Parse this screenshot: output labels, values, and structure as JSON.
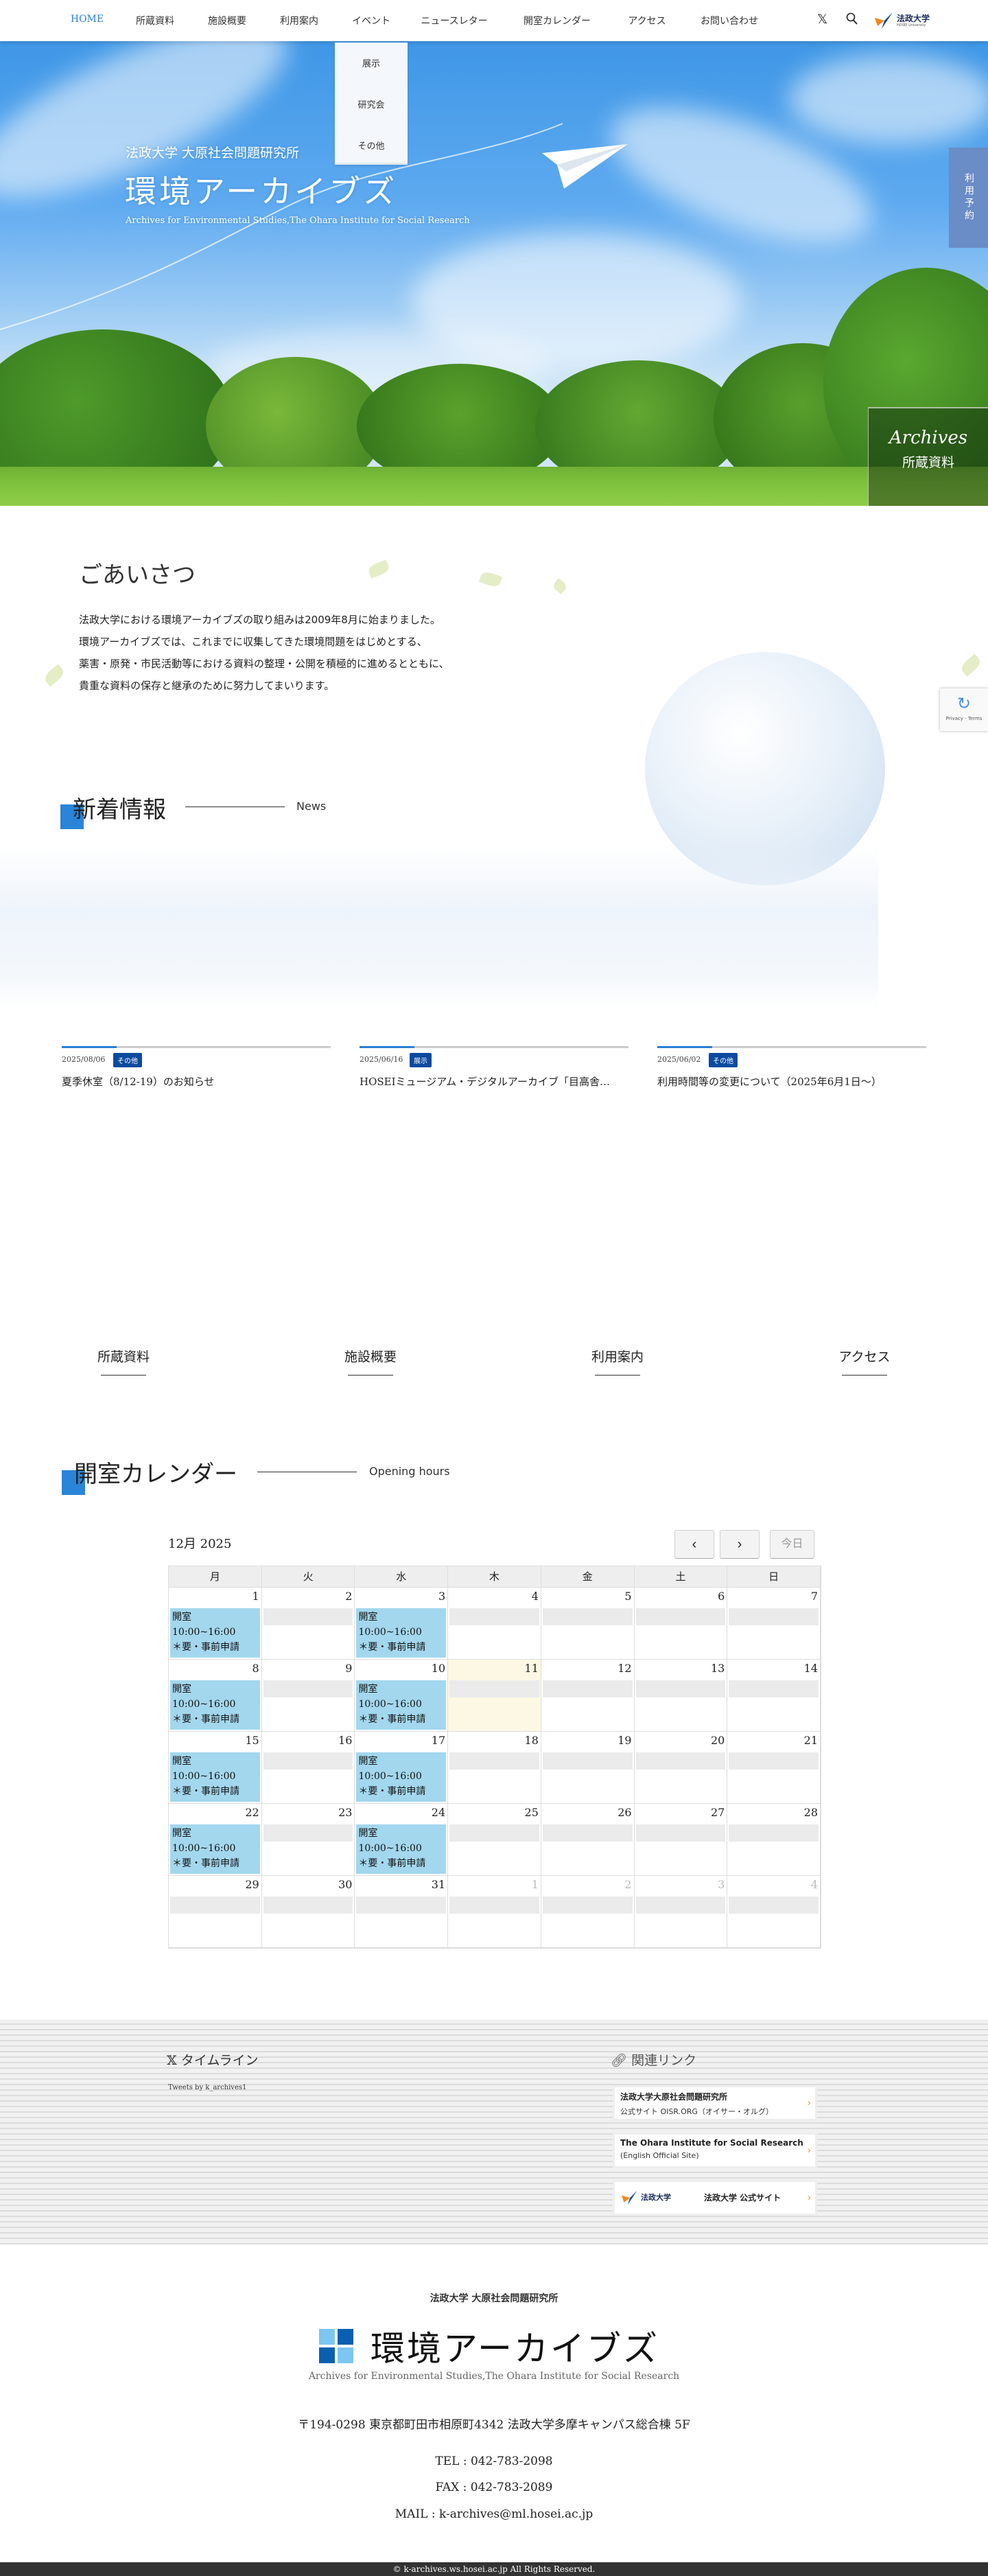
{
  "header": {
    "nav": [
      "HOME",
      "所蔵資料",
      "施設概要",
      "利用案内",
      "イベント",
      "ニュースレター",
      "開室カレンダー",
      "アクセス",
      "お問い合わせ"
    ],
    "event_dropdown": [
      "展示",
      "研究会",
      "その他"
    ],
    "logo_text": "法政大学",
    "logo_sub": "HOSEI University",
    "colors": {
      "accent": "#2a7fd4",
      "tag": "#0c4aa0",
      "reserve": "#6a8cc7"
    }
  },
  "hero": {
    "org": "法政大学 大原社会問題研究所",
    "title": "環境アーカイブズ",
    "subtitle": "Archives for Environmental Studies,The Ohara Institute for Social Research",
    "reserve_tab": "利用予約",
    "archives_script": "Archives",
    "archives_label": "所蔵資料"
  },
  "greeting": {
    "title": "ごあいさつ",
    "lines": [
      "法政大学における環境アーカイブズの取り組みは2009年8月に始まりました。",
      "環境アーカイブズでは、これまでに収集してきた環境問題をはじめとする、",
      "薬害・原発・市民活動等における資料の整理・公開を積極的に進めるとともに、",
      "貴重な資料の保存と継承のために努力してまいります。"
    ]
  },
  "news": {
    "title": "新着情報",
    "sub": "News",
    "items": [
      {
        "date": "2025/08/06",
        "tag": "その他",
        "title": "夏季休室（8/12-19）のお知らせ"
      },
      {
        "date": "2025/06/16",
        "tag": "展示",
        "title": "HOSEIミュージアム・デジタルアーカイブ「目高舎…"
      },
      {
        "date": "2025/06/02",
        "tag": "その他",
        "title": "利用時間等の変更について（2025年6月1日〜）"
      }
    ]
  },
  "quick_links": [
    "所蔵資料",
    "施設概要",
    "利用案内",
    "アクセス"
  ],
  "calendar": {
    "title": "開室カレンダー",
    "sub": "Opening hours",
    "month": "12月 2025",
    "prev": "‹",
    "next": "›",
    "today_btn": "今日",
    "weekdays": [
      "月",
      "火",
      "水",
      "木",
      "金",
      "土",
      "日"
    ],
    "event_lines": [
      "開室",
      "10:00~16:00",
      "＊要・事前申請"
    ],
    "weeks": [
      [
        {
          "d": 1,
          "open": true
        },
        {
          "d": 2
        },
        {
          "d": 3,
          "open": true
        },
        {
          "d": 4
        },
        {
          "d": 5
        },
        {
          "d": 6
        },
        {
          "d": 7
        }
      ],
      [
        {
          "d": 8,
          "open": true
        },
        {
          "d": 9
        },
        {
          "d": 10,
          "open": true
        },
        {
          "d": 11,
          "today": true
        },
        {
          "d": 12
        },
        {
          "d": 13
        },
        {
          "d": 14
        }
      ],
      [
        {
          "d": 15,
          "open": true
        },
        {
          "d": 16
        },
        {
          "d": 17,
          "open": true
        },
        {
          "d": 18
        },
        {
          "d": 19
        },
        {
          "d": 20
        },
        {
          "d": 21
        }
      ],
      [
        {
          "d": 22,
          "open": true
        },
        {
          "d": 23
        },
        {
          "d": 24,
          "open": true
        },
        {
          "d": 25
        },
        {
          "d": 26
        },
        {
          "d": 27
        },
        {
          "d": 28
        }
      ],
      [
        {
          "d": 29
        },
        {
          "d": 30
        },
        {
          "d": 31
        },
        {
          "d": 1,
          "other": true
        },
        {
          "d": 2,
          "other": true
        },
        {
          "d": 3,
          "other": true
        },
        {
          "d": 4,
          "other": true
        }
      ]
    ]
  },
  "timeline": {
    "title": "タイムライン",
    "tweets": "Tweets by k_archives1"
  },
  "related": {
    "title": "関連リンク",
    "items": [
      {
        "title": "法政大学大原社会問題研究所",
        "sub": "公式サイト OISR.ORG（オイサー・オルグ）"
      },
      {
        "title": "The Ohara Institute for Social Research",
        "sub": "(English Official Site)"
      },
      {
        "title": "法政大学 公式サイト",
        "logo": "法政大学"
      }
    ]
  },
  "footer": {
    "org": "法政大学 大原社会問題研究所",
    "logo_title": "環境アーカイブズ",
    "logo_sub": "Archives for Environmental Studies,The Ohara Institute for Social Research",
    "address": "〒194-0298 東京都町田市相原町4342 法政大学多摩キャンパス総合棟 5F",
    "tel": "TEL : 042-783-2098",
    "fax": "FAX : 042-783-2089",
    "mail": "MAIL : k-archives@ml.hosei.ac.jp",
    "copyright": "© k-archives.ws.hosei.ac.jp  All  Rights  Reserved."
  },
  "recaptcha": "Privacy - Terms"
}
